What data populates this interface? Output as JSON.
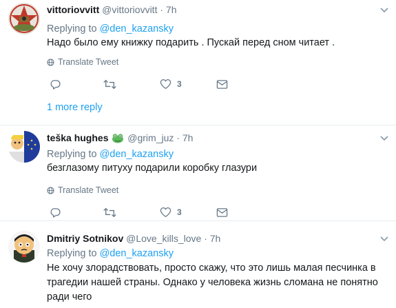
{
  "labels": {
    "replying_prefix": "Replying to",
    "translate": "Translate Tweet",
    "more_replies": "1 more reply"
  },
  "tweets": [
    {
      "name": "vittoriovvitt",
      "handle": "@vittoriovvitt",
      "dot": "·",
      "time": "7h",
      "reply_to": "@den_kazansky",
      "text": "Надо было ему книжку подарить . Пускай перед сном читает .",
      "likes": "3"
    },
    {
      "name": "teška hughes",
      "handle": "@grim_juz",
      "dot": "·",
      "time": "7h",
      "reply_to": "@den_kazansky",
      "text": "безглазому питуху подарили коробку глазури",
      "likes": "3"
    },
    {
      "name": "Dmitriy Sotnikov",
      "handle": "@Love_kills_love",
      "dot": "·",
      "time": "7h",
      "reply_to": "@den_kazansky",
      "text": "Не хочу злорадствовать, просто скажу, что это лишь малая песчинка в трагедии нашей страны. Однако у человека жизнь сломана не понятно ради чего",
      "likes": ""
    }
  ],
  "colors": {
    "accent": "#1da1f2",
    "muted": "#657786",
    "divider": "#e6ecf0"
  }
}
